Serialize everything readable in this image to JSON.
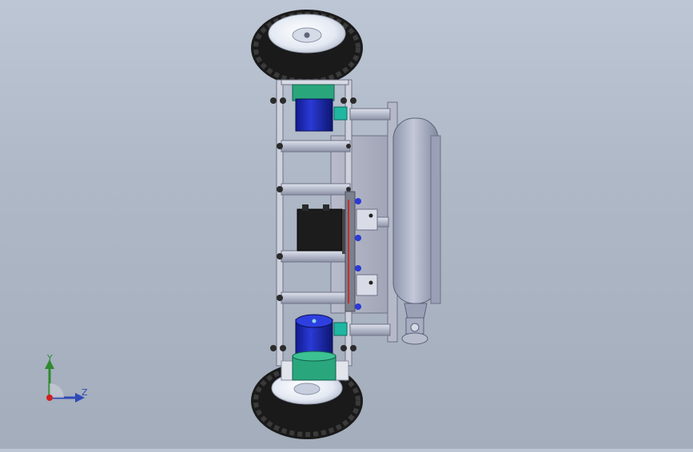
{
  "viewport": {
    "background_top": "#bcc6d4",
    "background_bottom": "#a3adbb"
  },
  "triad": {
    "y_label": "Y",
    "z_label": "Z",
    "y_color": "#2f8a2f",
    "z_color": "#2f49b6",
    "x_color": "#d02020"
  },
  "model": {
    "tire_color": "#1a1a1a",
    "rim_color": "#e9eef7",
    "frame_color": "#c9ccd6",
    "motor_color": "#1e2bc4",
    "motor_collar_color": "#2aa67d",
    "tank_color": "#aab0c6",
    "battery_color": "#1c1c1c"
  }
}
